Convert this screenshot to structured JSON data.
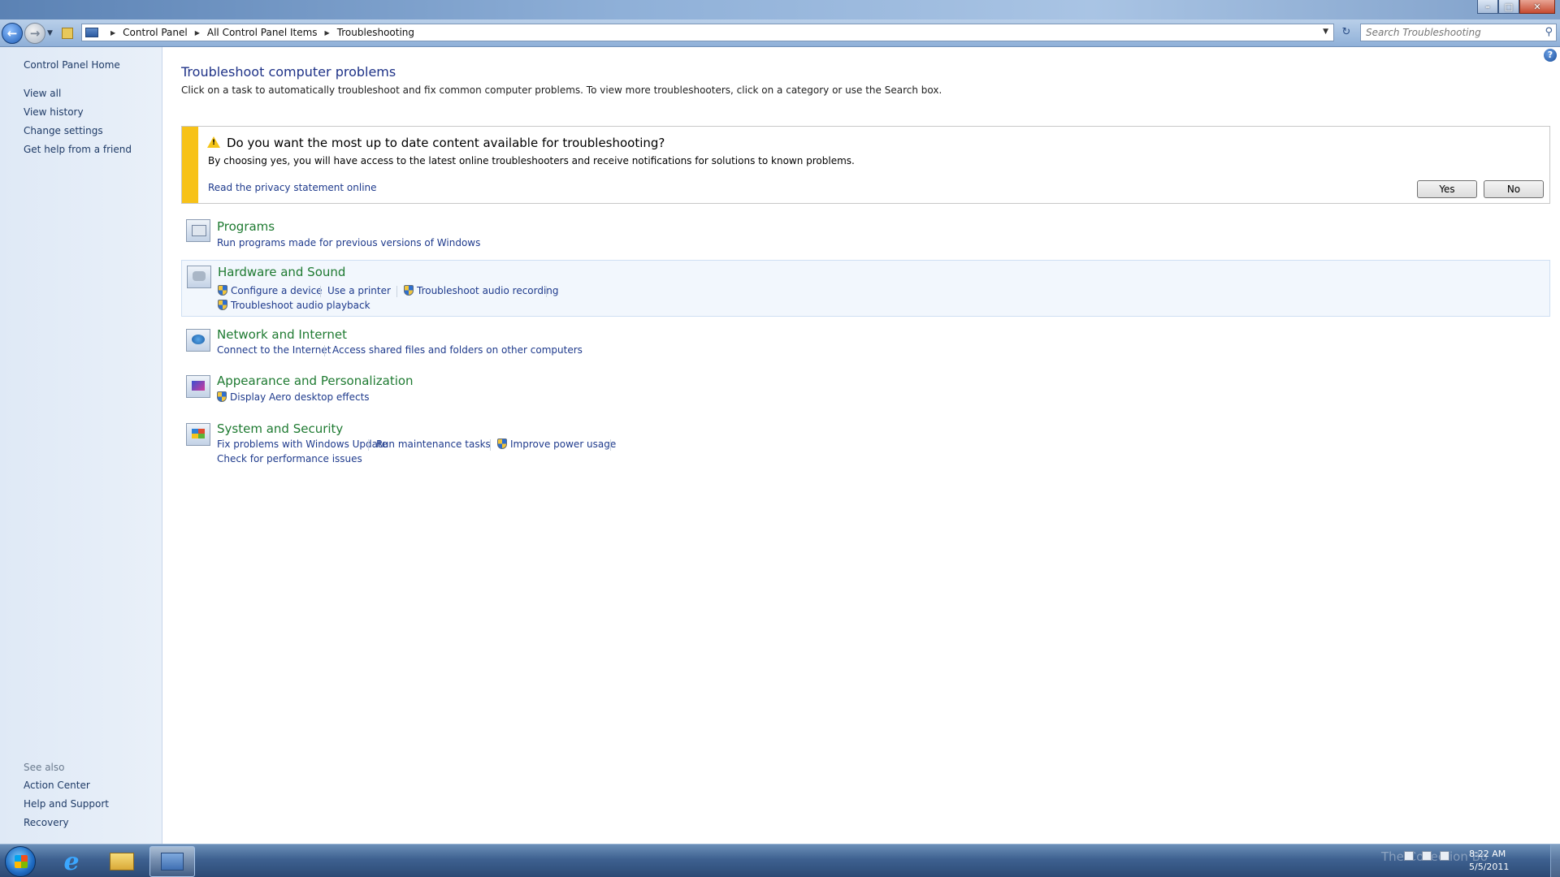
{
  "window": {
    "caption_buttons": {
      "minimize": "–",
      "maximize": "□",
      "close": "✕"
    }
  },
  "nav": {
    "breadcrumbs": [
      "Control Panel",
      "All Control Panel Items",
      "Troubleshooting"
    ],
    "search_placeholder": "Search Troubleshooting"
  },
  "sidebar": {
    "home": "Control Panel Home",
    "links": [
      "View all",
      "View history",
      "Change settings",
      "Get help from a friend"
    ],
    "see_also_heading": "See also",
    "see_also": [
      "Action Center",
      "Help and Support",
      "Recovery"
    ]
  },
  "main": {
    "title": "Troubleshoot computer problems",
    "description": "Click on a task to automatically troubleshoot and fix common computer problems. To view more troubleshooters, click on a category or use the Search box.",
    "infobar": {
      "title": "Do you want the most up to date content available for troubleshooting?",
      "text": "By choosing yes, you will have access to the latest online troubleshooters and receive notifications for solutions to known problems.",
      "privacy_link": "Read the privacy statement online",
      "yes_label": "Yes",
      "no_label": "No"
    },
    "categories": [
      {
        "title": "Programs",
        "tasks": [
          "Run programs made for previous versions of Windows"
        ]
      },
      {
        "title": "Hardware and Sound",
        "tasks": [
          "Configure a device",
          "Use a printer",
          "Troubleshoot audio recording",
          "Troubleshoot audio playback"
        ]
      },
      {
        "title": "Network and Internet",
        "tasks": [
          "Connect to the Internet",
          "Access shared files and folders on other computers"
        ]
      },
      {
        "title": "Appearance and Personalization",
        "tasks": [
          "Display Aero desktop effects"
        ]
      },
      {
        "title": "System and Security",
        "tasks": [
          "Fix problems with Windows Update",
          "Run maintenance tasks",
          "Improve power usage",
          "Check for performance issues"
        ]
      }
    ]
  },
  "taskbar": {
    "clock_time": "8:22 AM",
    "clock_date": "5/5/2011",
    "watermark": "The Collection Bo"
  },
  "colors": {
    "link": "#1e3a8c",
    "category_title": "#1e7a31",
    "info_strip": "#f7c218",
    "sidebar_bg": "#dfe9f6"
  }
}
